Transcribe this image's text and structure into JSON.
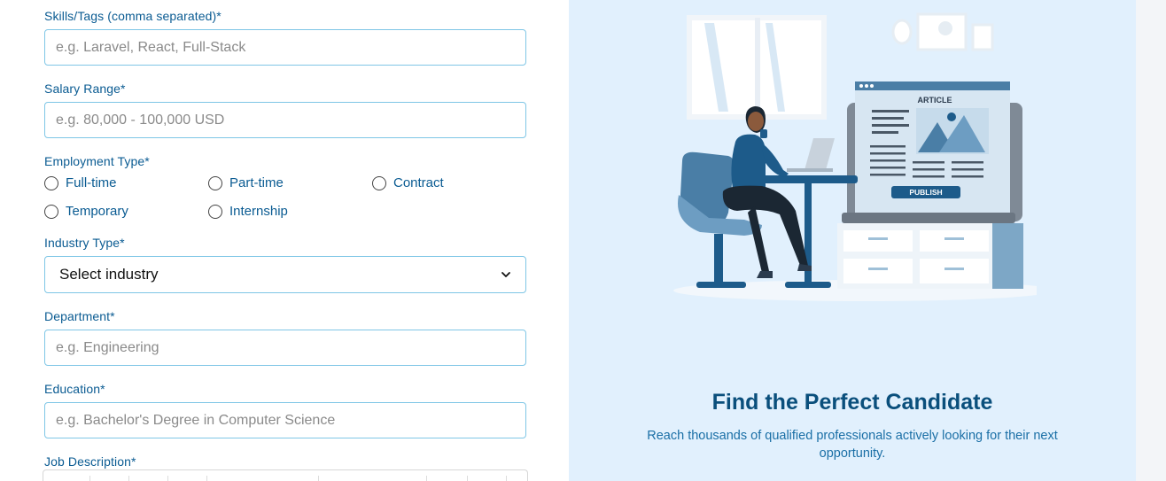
{
  "form": {
    "skills": {
      "label": "Skills/Tags (comma separated)*",
      "placeholder": "e.g. Laravel, React, Full-Stack"
    },
    "salary": {
      "label": "Salary Range*",
      "placeholder": "e.g. 80,000 - 100,000 USD"
    },
    "employment": {
      "label": "Employment Type*",
      "options": [
        "Full-time",
        "Part-time",
        "Contract",
        "Temporary",
        "Internship"
      ]
    },
    "industry": {
      "label": "Industry Type*",
      "selected": "Select industry"
    },
    "department": {
      "label": "Department*",
      "placeholder": "e.g. Engineering"
    },
    "education": {
      "label": "Education*",
      "placeholder": "e.g. Bachelor's Degree in Computer Science"
    },
    "description": {
      "label": "Job Description*"
    }
  },
  "promo": {
    "title": "Find the Perfect Candidate",
    "subtitle": "Reach thousands of qualified professionals actively looking for their next opportunity.",
    "illustration": {
      "article_label": "ARTICLE",
      "publish_label": "PUBLISH"
    }
  },
  "colors": {
    "label_blue": "#0a5b92",
    "input_border": "#7fc6e6",
    "panel_bg": "#e1f0fd",
    "headline": "#0a4f7c"
  }
}
